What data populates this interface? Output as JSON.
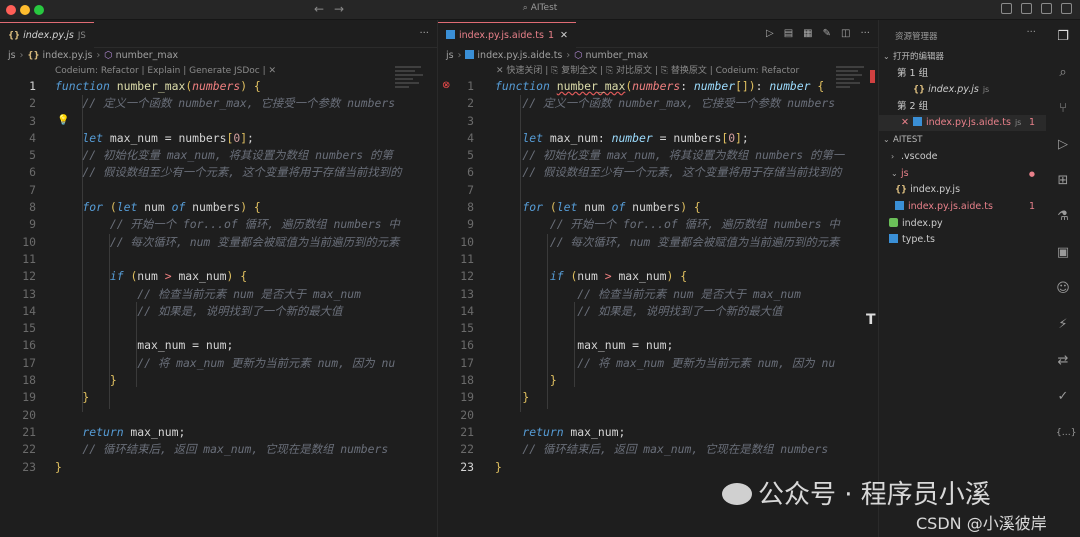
{
  "window": {
    "title": "AITest"
  },
  "left_editor": {
    "tab": {
      "lang_badge": "{}",
      "name": "index.py.js",
      "lang": "JS"
    },
    "breadcrumb": [
      "js",
      "index.py.js",
      "number_max"
    ],
    "codelens": "Codeium: Refactor | Explain | Generate JSDoc | ✕",
    "lines": [
      [
        [
          "kw",
          "function"
        ],
        [
          "id",
          " "
        ],
        [
          "fn",
          "number_max"
        ],
        [
          "br",
          "("
        ],
        [
          "pm",
          "numbers"
        ],
        [
          "br",
          ")"
        ],
        [
          "id",
          " "
        ],
        [
          "br",
          "{"
        ]
      ],
      [
        [
          "cm",
          "    // 定义一个函数 number_max, 它接受一个参数 numbers"
        ]
      ],
      [],
      [
        [
          "kw",
          "    let"
        ],
        [
          "id",
          " max_num = numbers"
        ],
        [
          "br",
          "["
        ],
        [
          "nu",
          "0"
        ],
        [
          "br",
          "]"
        ],
        [
          "id",
          ";"
        ]
      ],
      [
        [
          "cm",
          "    // 初始化变量 max_num, 将其设置为数组 numbers 的第"
        ]
      ],
      [
        [
          "cm",
          "    // 假设数组至少有一个元素, 这个变量将用于存储当前找到的"
        ]
      ],
      [],
      [
        [
          "kw",
          "    for"
        ],
        [
          "id",
          " "
        ],
        [
          "br",
          "("
        ],
        [
          "kw",
          "let"
        ],
        [
          "id",
          " num "
        ],
        [
          "kw",
          "of"
        ],
        [
          "id",
          " numbers"
        ],
        [
          "br",
          ")"
        ],
        [
          "id",
          " "
        ],
        [
          "br",
          "{"
        ]
      ],
      [
        [
          "cm",
          "        // 开始一个 for...of 循环, 遍历数组 numbers 中"
        ]
      ],
      [
        [
          "cm",
          "        // 每次循环, num 变量都会被赋值为当前遍历到的元素"
        ]
      ],
      [],
      [
        [
          "kw",
          "        if"
        ],
        [
          "id",
          " "
        ],
        [
          "br",
          "("
        ],
        [
          "id",
          "num "
        ],
        [
          "op",
          ">"
        ],
        [
          "id",
          " max_num"
        ],
        [
          "br",
          ")"
        ],
        [
          "id",
          " "
        ],
        [
          "br",
          "{"
        ]
      ],
      [
        [
          "cm",
          "            // 检查当前元素 num 是否大于 max_num"
        ]
      ],
      [
        [
          "cm",
          "            // 如果是, 说明找到了一个新的最大值"
        ]
      ],
      [],
      [
        [
          "id",
          "            max_num = num;"
        ]
      ],
      [
        [
          "cm",
          "            // 将 max_num 更新为当前元素 num, 因为 nu"
        ]
      ],
      [
        [
          "br",
          "        }"
        ]
      ],
      [
        [
          "br",
          "    }"
        ]
      ],
      [],
      [
        [
          "kw",
          "    return"
        ],
        [
          "id",
          " max_num;"
        ]
      ],
      [
        [
          "cm",
          "    // 循环结束后, 返回 max_num, 它现在是数组 numbers"
        ]
      ],
      [
        [
          "br",
          "}"
        ]
      ]
    ]
  },
  "right_editor": {
    "tab": {
      "name": "index.py.js.aide.ts",
      "count": "1"
    },
    "breadcrumb": [
      "js",
      "index.py.js.aide.ts",
      "number_max"
    ],
    "codelens": "✕ 快速关闭 | ⎘ 复制全文 | ⎘ 对比原文 | ⎘ 替换原文 | Codeium: Refactor",
    "lines": [
      [
        [
          "kw",
          "function"
        ],
        [
          "id",
          " "
        ],
        [
          "fn",
          "number_max"
        ],
        [
          "br",
          "("
        ],
        [
          "pm",
          "numbers"
        ],
        [
          "id",
          ": "
        ],
        [
          "ty",
          "number"
        ],
        [
          "br",
          "[]"
        ],
        [
          "br",
          ")"
        ],
        [
          "id",
          ": "
        ],
        [
          "ty",
          "number"
        ],
        [
          "id",
          " "
        ],
        [
          "br",
          "{"
        ]
      ],
      [
        [
          "cm",
          "    // 定义一个函数 number_max, 它接受一个参数 numbers"
        ]
      ],
      [],
      [
        [
          "kw",
          "    let"
        ],
        [
          "id",
          " max_num: "
        ],
        [
          "ty",
          "number"
        ],
        [
          "id",
          " = numbers"
        ],
        [
          "br",
          "["
        ],
        [
          "nu",
          "0"
        ],
        [
          "br",
          "]"
        ],
        [
          "id",
          ";"
        ]
      ],
      [
        [
          "cm",
          "    // 初始化变量 max_num, 将其设置为数组 numbers 的第一"
        ]
      ],
      [
        [
          "cm",
          "    // 假设数组至少有一个元素, 这个变量将用于存储当前找到的"
        ]
      ],
      [],
      [
        [
          "kw",
          "    for"
        ],
        [
          "id",
          " "
        ],
        [
          "br",
          "("
        ],
        [
          "kw",
          "let"
        ],
        [
          "id",
          " num "
        ],
        [
          "kw",
          "of"
        ],
        [
          "id",
          " numbers"
        ],
        [
          "br",
          ")"
        ],
        [
          "id",
          " "
        ],
        [
          "br",
          "{"
        ]
      ],
      [
        [
          "cm",
          "        // 开始一个 for...of 循环, 遍历数组 numbers 中"
        ]
      ],
      [
        [
          "cm",
          "        // 每次循环, num 变量都会被赋值为当前遍历到的元素"
        ]
      ],
      [],
      [
        [
          "kw",
          "        if"
        ],
        [
          "id",
          " "
        ],
        [
          "br",
          "("
        ],
        [
          "id",
          "num "
        ],
        [
          "op",
          ">"
        ],
        [
          "id",
          " max_num"
        ],
        [
          "br",
          ")"
        ],
        [
          "id",
          " "
        ],
        [
          "br",
          "{"
        ]
      ],
      [
        [
          "cm",
          "            // 检查当前元素 num 是否大于 max_num"
        ]
      ],
      [
        [
          "cm",
          "            // 如果是, 说明找到了一个新的最大值"
        ]
      ],
      [],
      [
        [
          "id",
          "            max_num = num;"
        ]
      ],
      [
        [
          "cm",
          "            // 将 max_num 更新为当前元素 num, 因为 nu"
        ]
      ],
      [
        [
          "br",
          "        }"
        ]
      ],
      [
        [
          "br",
          "    }"
        ]
      ],
      [],
      [
        [
          "kw",
          "    return"
        ],
        [
          "id",
          " max_num;"
        ]
      ],
      [
        [
          "cm",
          "    // 循环结束后, 返回 max_num, 它现在是数组 numbers"
        ]
      ],
      [
        [
          "br",
          "}"
        ]
      ]
    ]
  },
  "line_numbers": [
    "1",
    "2",
    "3",
    "4",
    "5",
    "6",
    "7",
    "8",
    "9",
    "10",
    "11",
    "12",
    "13",
    "14",
    "15",
    "16",
    "17",
    "18",
    "19",
    "20",
    "21",
    "22",
    "23"
  ],
  "explorer": {
    "title": "资源管理器",
    "open_editors": "打开的编辑器",
    "group1": "第 1 组",
    "group1_file": "index.py.js",
    "group1_file_lang": "js",
    "group2": "第 2 组",
    "group2_file": "index.py.js.aide.ts",
    "group2_file_lang": "js",
    "group2_count": "1",
    "project": "AITEST",
    "items": [
      {
        "label": ".vscode"
      },
      {
        "label": "js"
      },
      {
        "label": "index.py.js"
      },
      {
        "label": "index.py.js.aide.ts",
        "count": "1"
      },
      {
        "label": "index.py"
      },
      {
        "label": "type.ts"
      }
    ]
  },
  "watermark": {
    "line1": "公众号 · 程序员小溪",
    "line2": "CSDN @小溪彼岸"
  }
}
